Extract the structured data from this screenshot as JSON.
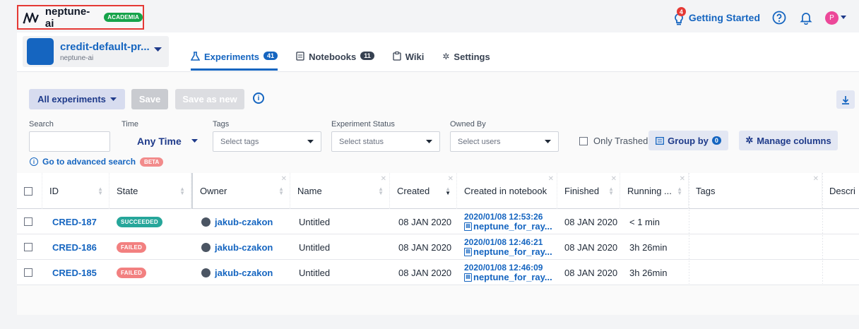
{
  "topbar": {
    "org_name": "neptune-ai",
    "org_badge": "ACADEMIA",
    "getting_started": "Getting Started",
    "notification_count": "4",
    "avatar_initial": "P"
  },
  "project": {
    "name": "credit-default-pr...",
    "org": "neptune-ai",
    "color": "#1565c0"
  },
  "tabs": [
    {
      "label": "Experiments",
      "count": "41",
      "icon": "flask-icon"
    },
    {
      "label": "Notebooks",
      "count": "11",
      "icon": "notebook-icon"
    },
    {
      "label": "Wiki",
      "icon": "wiki-icon"
    },
    {
      "label": "Settings",
      "icon": "gear-icon"
    }
  ],
  "toolbar": {
    "view_select": "All experiments",
    "save": "Save",
    "save_as_new": "Save as new"
  },
  "filters": {
    "search_label": "Search",
    "time_label": "Time",
    "time_value": "Any Time",
    "tags_label": "Tags",
    "tags_placeholder": "Select tags",
    "status_label": "Experiment Status",
    "status_placeholder": "Select status",
    "owned_label": "Owned By",
    "owned_placeholder": "Select users",
    "only_trashed": "Only Trashed",
    "group_by": "Group by",
    "group_count": "0",
    "manage_columns": "Manage columns",
    "advanced_search": "Go to advanced search",
    "beta": "BETA"
  },
  "columns": [
    "ID",
    "State",
    "Owner",
    "Name",
    "Created",
    "Created in notebook",
    "Finished",
    "Running ...",
    "Tags",
    "Descri"
  ],
  "rows": [
    {
      "id": "CRED-187",
      "state": "SUCCEEDED",
      "state_color": "#26a69a",
      "owner": "jakub-czakon",
      "name": "Untitled",
      "created": "08 JAN 2020",
      "nb_time": "2020/01/08 12:53:26",
      "nb_file": "neptune_for_ray...",
      "finished": "08 JAN 2020",
      "running": "< 1 min"
    },
    {
      "id": "CRED-186",
      "state": "FAILED",
      "state_color": "#f28080",
      "owner": "jakub-czakon",
      "name": "Untitled",
      "created": "08 JAN 2020",
      "nb_time": "2020/01/08 12:46:21",
      "nb_file": "neptune_for_ray...",
      "finished": "08 JAN 2020",
      "running": "3h 26min"
    },
    {
      "id": "CRED-185",
      "state": "FAILED",
      "state_color": "#f28080",
      "owner": "jakub-czakon",
      "name": "Untitled",
      "created": "08 JAN 2020",
      "nb_time": "2020/01/08 12:46:09",
      "nb_file": "neptune_for_ray...",
      "finished": "08 JAN 2020",
      "running": "3h 26min"
    }
  ]
}
